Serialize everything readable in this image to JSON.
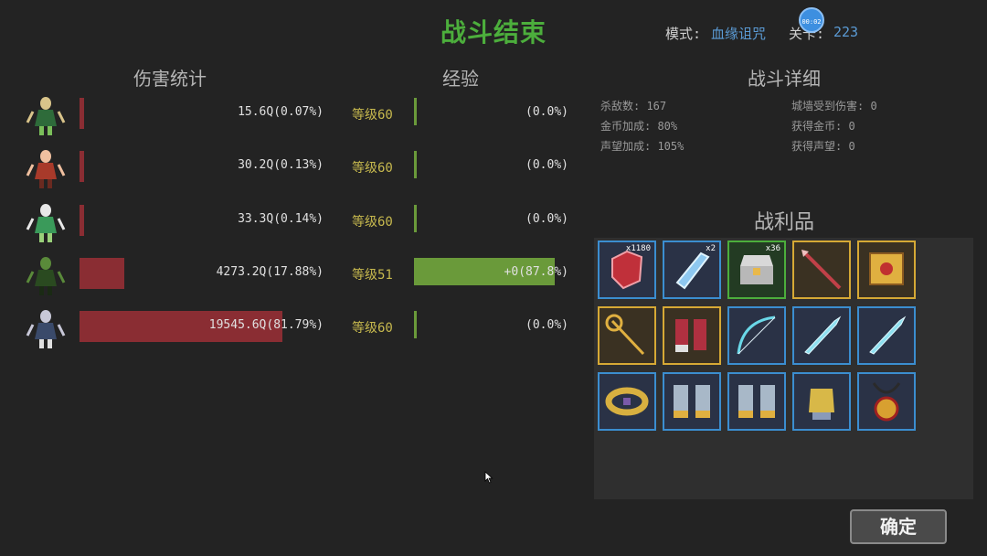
{
  "header": {
    "title": "战斗结束",
    "mode_label": "模式:",
    "mode_value": "血缘诅咒",
    "level_label": "关卡:",
    "level_value": "223",
    "timer": "00:02"
  },
  "sections": {
    "damage": "伤害统计",
    "experience": "经验",
    "battle_details": "战斗详细",
    "loot": "战利品"
  },
  "heroes": [
    {
      "damage": "15.6Q(0.07%)",
      "damage_fraction": 0.0007,
      "level": "等级60",
      "exp": "(0.0%)",
      "exp_fraction": 0.0
    },
    {
      "damage": "30.2Q(0.13%)",
      "damage_fraction": 0.0013,
      "level": "等级60",
      "exp": "(0.0%)",
      "exp_fraction": 0.0
    },
    {
      "damage": "33.3Q(0.14%)",
      "damage_fraction": 0.0014,
      "level": "等级60",
      "exp": "(0.0%)",
      "exp_fraction": 0.0
    },
    {
      "damage": "4273.2Q(17.88%)",
      "damage_fraction": 0.1788,
      "level": "等级51",
      "exp": "+0(87.8%)",
      "exp_fraction": 0.878
    },
    {
      "damage": "19545.6Q(81.79%)",
      "damage_fraction": 0.8179,
      "level": "等级60",
      "exp": "(0.0%)",
      "exp_fraction": 0.0
    }
  ],
  "stats": {
    "kills": "杀敌数: 167",
    "gold_bonus": "金币加成: 80%",
    "fame_bonus": "声望加成: 105%",
    "wall_damage": "城墙受到伤害: 0",
    "gold_gained": "获得金币: 0",
    "fame_gained": "获得声望: 0"
  },
  "loot": [
    {
      "icon": "red-gem-icon",
      "qty": "x1180",
      "rarity": "blue"
    },
    {
      "icon": "blue-crystal-icon",
      "qty": "x2",
      "rarity": "blue"
    },
    {
      "icon": "treasure-chest-icon",
      "qty": "x36",
      "rarity": "green"
    },
    {
      "icon": "crimson-spear-icon",
      "qty": "",
      "rarity": "gold"
    },
    {
      "icon": "golden-tome-icon",
      "qty": "",
      "rarity": "gold"
    },
    {
      "icon": "golden-staff-icon",
      "qty": "",
      "rarity": "gold"
    },
    {
      "icon": "red-boots-icon",
      "qty": "",
      "rarity": "gold"
    },
    {
      "icon": "ice-bow-icon",
      "qty": "",
      "rarity": "blue"
    },
    {
      "icon": "ice-dagger-icon",
      "qty": "",
      "rarity": "blue"
    },
    {
      "icon": "ice-dagger-icon",
      "qty": "",
      "rarity": "blue"
    },
    {
      "icon": "gold-belt-icon",
      "qty": "",
      "rarity": "blue"
    },
    {
      "icon": "steel-boots-icon",
      "qty": "",
      "rarity": "blue"
    },
    {
      "icon": "steel-boots-icon",
      "qty": "",
      "rarity": "blue"
    },
    {
      "icon": "gold-gauntlet-icon",
      "qty": "",
      "rarity": "blue"
    },
    {
      "icon": "gold-amulet-icon",
      "qty": "",
      "rarity": "blue"
    }
  ],
  "colors": {
    "title": "#4cae3c",
    "accent_blue": "#5b9bd5",
    "damage_bar": "#8a2d33",
    "exp_bar": "#6a9a3a",
    "level_text": "#c7b94e"
  },
  "confirm_button": "确定"
}
